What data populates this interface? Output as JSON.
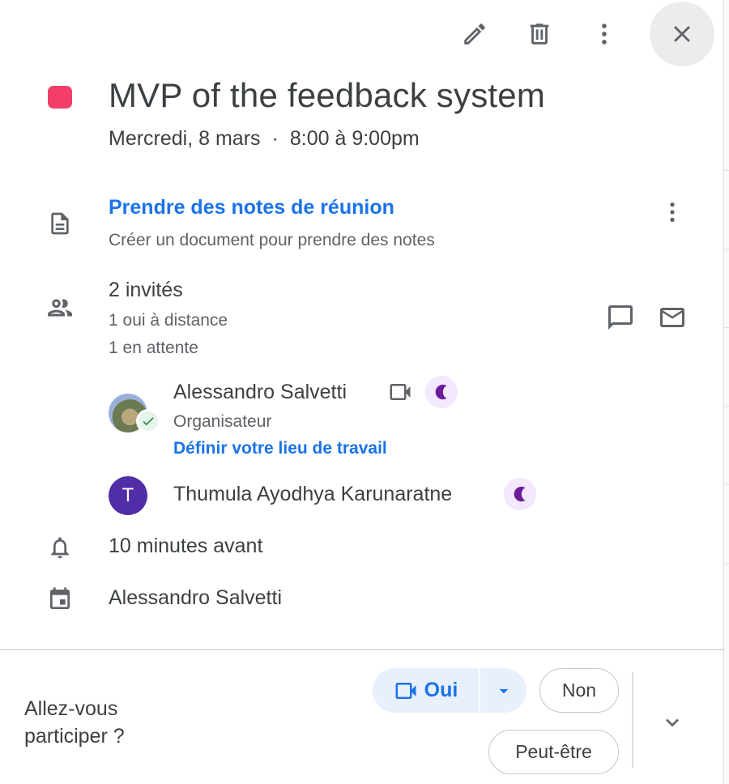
{
  "toolbar": {
    "edit_icon": "pencil-icon",
    "delete_icon": "trash-icon",
    "more_icon": "more-vert-icon",
    "close_icon": "close-icon"
  },
  "event": {
    "color": "#f33e6a",
    "title": "MVP of the feedback system",
    "date": "Mercredi, 8 mars",
    "separator": "·",
    "time": "8:00 à 9:00pm"
  },
  "notes": {
    "icon": "document-icon",
    "title": "Prendre des notes de réunion",
    "subtitle": "Créer un document pour prendre des notes"
  },
  "guests": {
    "icon": "people-icon",
    "count": "2 invités",
    "summary": [
      "1 oui à distance",
      "1 en attente"
    ],
    "list": [
      {
        "name": "Alessandro Salvetti",
        "role": "Organisateur",
        "link": "Définir votre lieu de travail",
        "status": "accepted",
        "joining": "video-icon",
        "badge": "moon-icon"
      },
      {
        "name": "Thumula Ayodhya Karunaratne",
        "initial": "T",
        "avatar_color": "#512da8",
        "badge": "moon-icon"
      }
    ]
  },
  "reminder": {
    "icon": "bell-icon",
    "text": "10 minutes avant"
  },
  "calendar": {
    "icon": "calendar-icon",
    "owner": "Alessandro Salvetti"
  },
  "rsvp": {
    "question": "Allez-vous participer ?",
    "yes_label": "Oui",
    "no_label": "Non",
    "maybe_label": "Peut-être",
    "accent": "#1a73e8"
  }
}
